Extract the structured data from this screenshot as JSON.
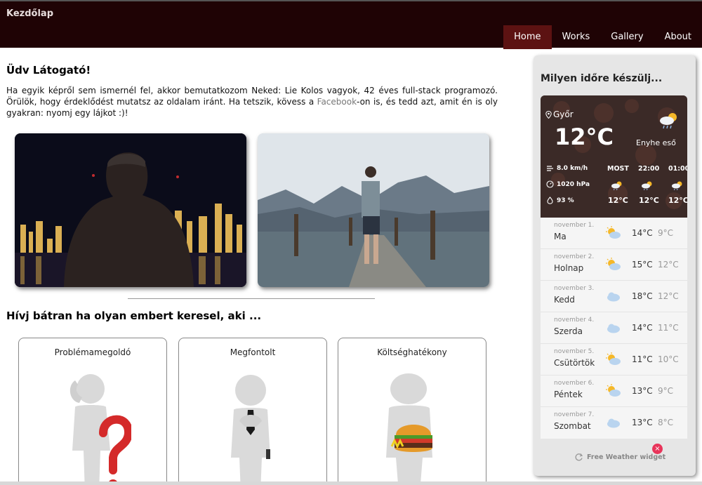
{
  "navbar": {
    "brand": "Kezdőlap",
    "items": [
      {
        "label": "Home",
        "active": true
      },
      {
        "label": "Works",
        "active": false
      },
      {
        "label": "Gallery",
        "active": false
      },
      {
        "label": "About",
        "active": false
      }
    ]
  },
  "welcome": {
    "title": "Üdv Látogató!",
    "text_before": "Ha egyik képről sem ismernél fel, akkor bemutatkozom Neked: Lie Kolos vagyok, 42 éves full-stack programozó. Örülök, hogy érdeklődést mutatsz az oldalam iránt. Ha tetszik, kövess a ",
    "link": "Facebook",
    "text_after": "-on is, és tedd azt, amit én is oly gyakran: nyomj egy lájkot :)!"
  },
  "call": {
    "title": "Hívj bátran ha olyan embert keresel, aki ...",
    "cards": [
      {
        "title": "Problémamegoldó"
      },
      {
        "title": "Megfontolt"
      },
      {
        "title": "Költséghatékony"
      }
    ]
  },
  "weather": {
    "title": "Milyen időre készülj...",
    "location": "Győr",
    "temperature": "12°C",
    "condition": "Enyhe eső",
    "wind": "8.0 km/h",
    "pressure": "1020 hPa",
    "humidity": "93 %",
    "hourly": [
      {
        "label": "MOST",
        "temp": "12°C"
      },
      {
        "label": "22:00",
        "temp": "12°C"
      },
      {
        "label": "01:00",
        "temp": "12°C"
      }
    ],
    "days": [
      {
        "date": "november 1.",
        "name": "Ma",
        "icon": "sun-cloud-icon",
        "hi": "14°C",
        "lo": "9°C"
      },
      {
        "date": "november 2.",
        "name": "Holnap",
        "icon": "sun-cloud-icon",
        "hi": "15°C",
        "lo": "12°C"
      },
      {
        "date": "november 3.",
        "name": "Kedd",
        "icon": "cloud-icon",
        "hi": "18°C",
        "lo": "12°C"
      },
      {
        "date": "november 4.",
        "name": "Szerda",
        "icon": "cloud-icon",
        "hi": "14°C",
        "lo": "11°C"
      },
      {
        "date": "november 5.",
        "name": "Csütörtök",
        "icon": "sun-cloud-icon",
        "hi": "11°C",
        "lo": "10°C"
      },
      {
        "date": "november 6.",
        "name": "Péntek",
        "icon": "sun-cloud-icon",
        "hi": "13°C",
        "lo": "9°C"
      },
      {
        "date": "november 7.",
        "name": "Szombat",
        "icon": "cloud-icon",
        "hi": "13°C",
        "lo": "8°C"
      }
    ],
    "footer": "Free Weather widget",
    "close_symbol": "×"
  },
  "colors": {
    "navbar_bg": "#1f0305",
    "nav_active_bg": "#5c1212",
    "weather_panel_bg": "#e6e6e6"
  }
}
